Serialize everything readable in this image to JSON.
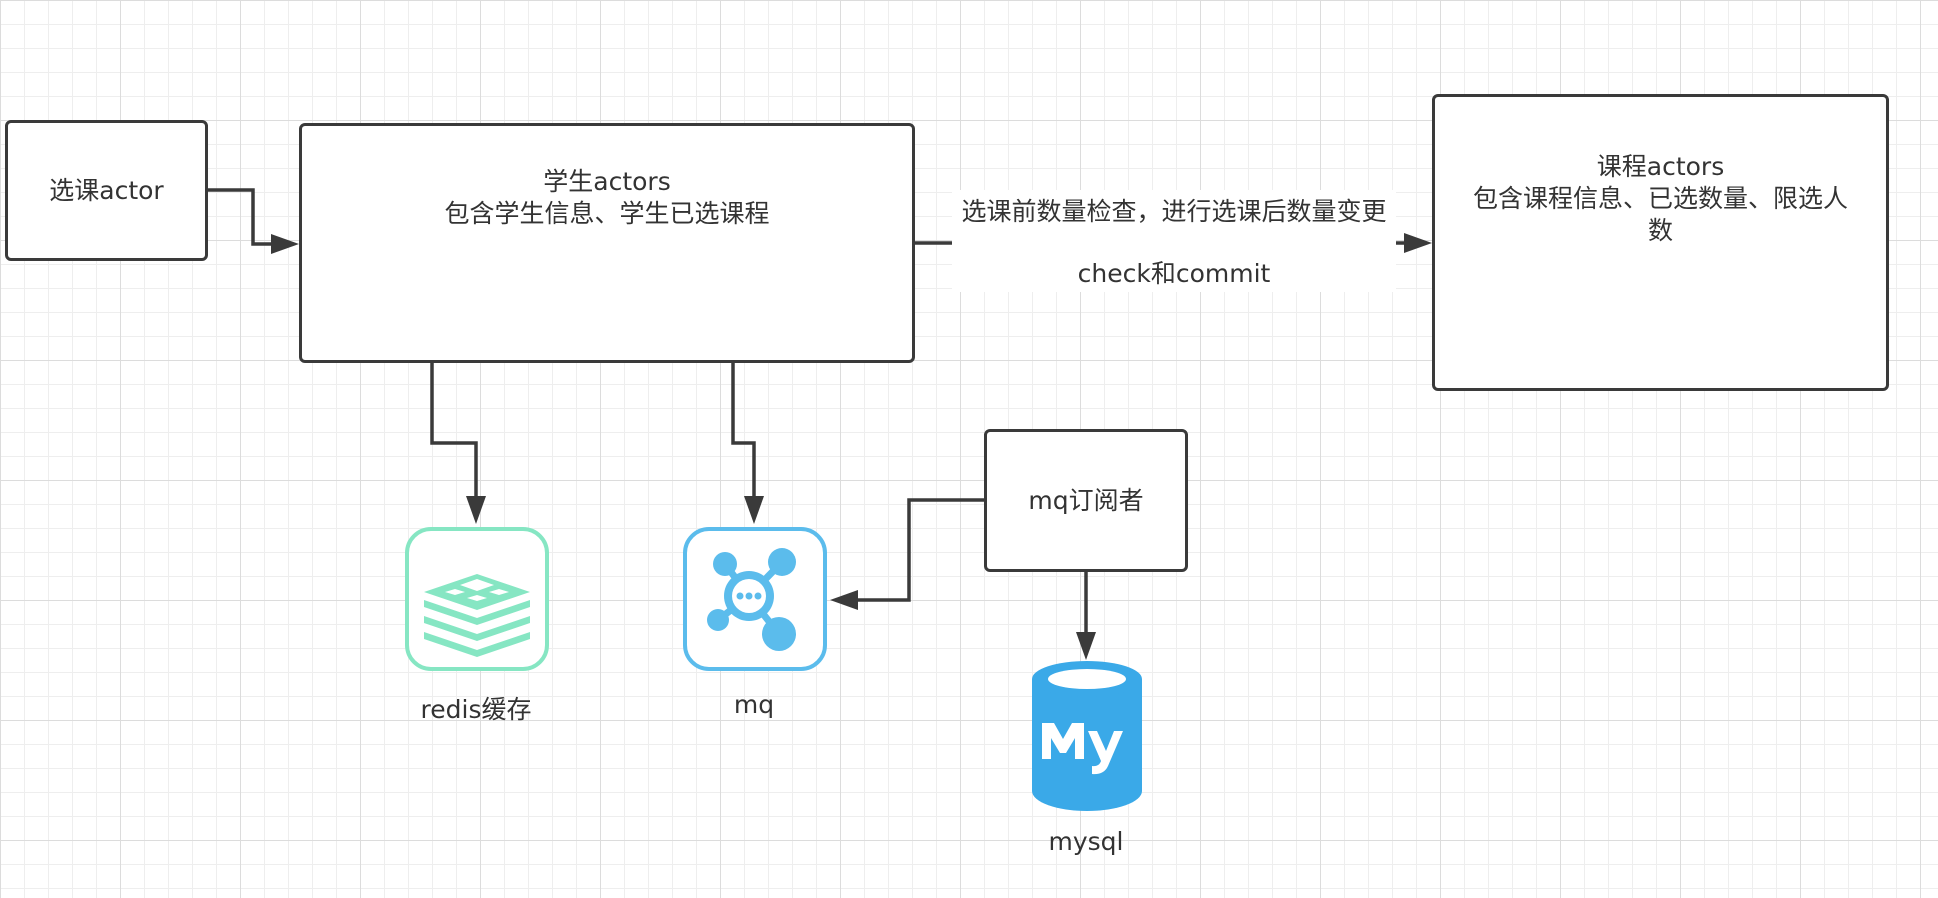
{
  "nodes": {
    "select_actor": {
      "label": "选课actor"
    },
    "student_actors": {
      "line1": "学生actors",
      "line2": "包含学生信息、学生已选课程"
    },
    "course_actors": {
      "line1": "课程actors",
      "line2": "包含课程信息、已选数量、限选人",
      "line3": "数"
    },
    "mq_subscriber": {
      "label": "mq订阅者"
    }
  },
  "edge_label": {
    "line1": "选课前数量检查，进行选课后数量变更",
    "line2": "check和commit"
  },
  "icons": {
    "redis": {
      "name": "redis-icon",
      "label": "redis缓存",
      "color": "#86e6c3"
    },
    "mq": {
      "name": "message-queue-icon",
      "label": "mq",
      "color": "#5bbcec"
    },
    "mysql": {
      "name": "mysql-database-icon",
      "label": "mysql",
      "color": "#3aa9e8"
    }
  },
  "colors": {
    "line": "#3a3a3a"
  }
}
